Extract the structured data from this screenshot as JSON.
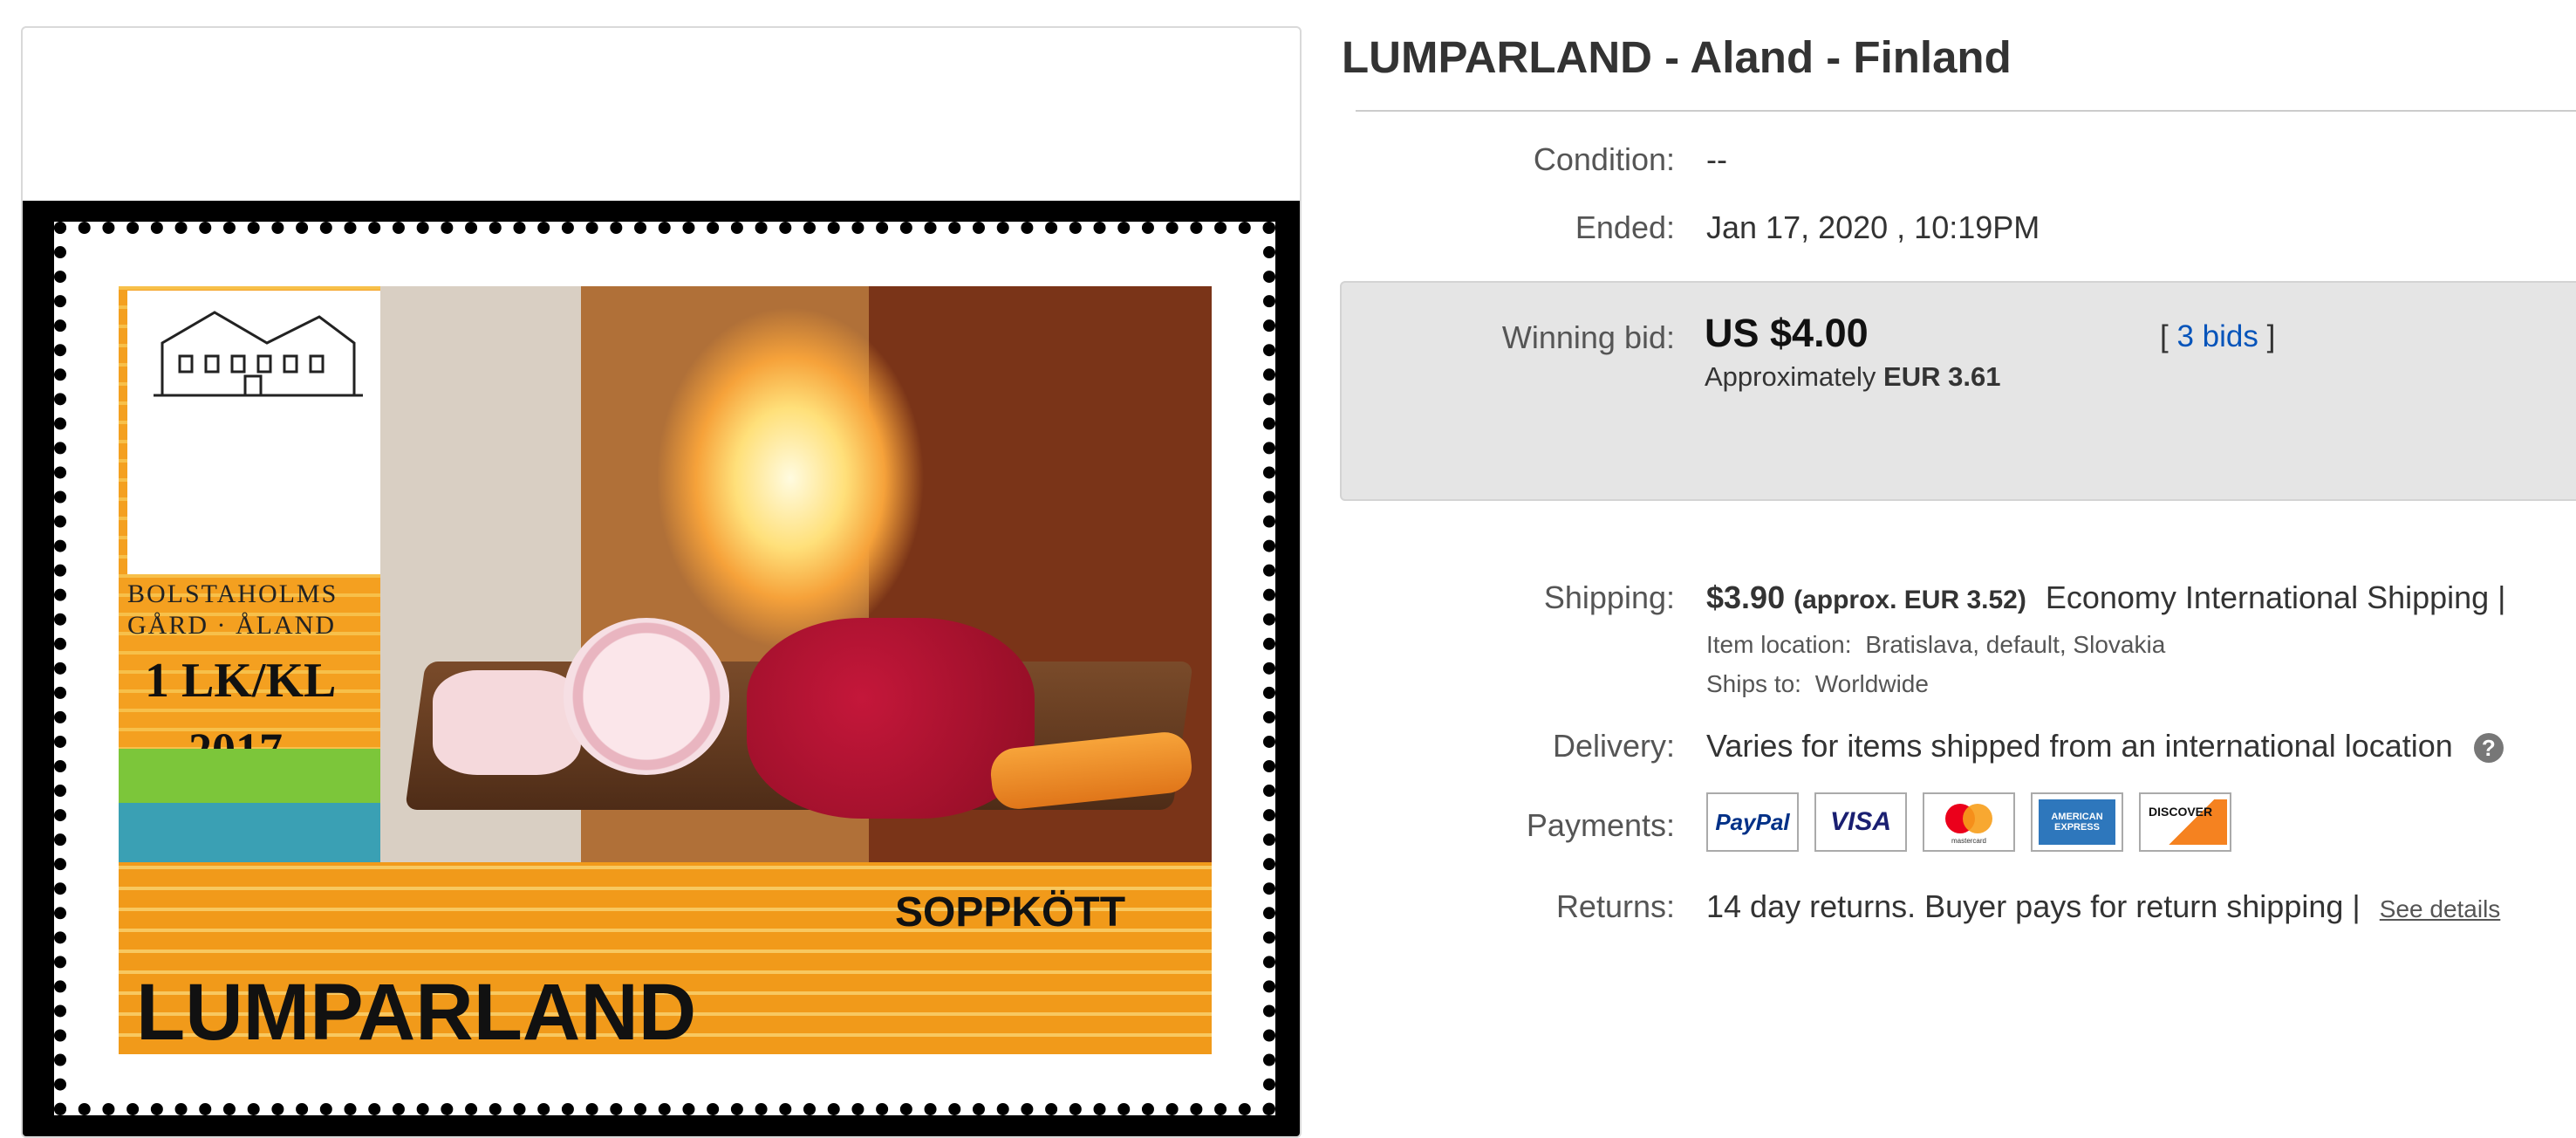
{
  "listing": {
    "title": "LUMPARLAND - Aland - Finland"
  },
  "stamp": {
    "estate_line1": "BOLSTAHOLMS",
    "estate_line2": "GÅRD · ÅLAND",
    "value": "1 LK/KL",
    "year": "2017",
    "caption": "SOPPKÖTT",
    "place": "LUMPARLAND"
  },
  "details": {
    "condition_label": "Condition:",
    "condition_value": "--",
    "ended_label": "Ended:",
    "ended_value": "Jan 17, 2020 , 10:19PM",
    "winning_bid_label": "Winning bid:",
    "winning_bid_value": "US $4.00",
    "approx_prefix": "Approximately",
    "approx_value": "EUR 3.61",
    "bids_open": "[",
    "bids_link": "3 bids",
    "bids_close": "]",
    "shipping_label": "Shipping:",
    "shipping_value": "$3.90",
    "shipping_approx": "(approx. EUR 3.52)",
    "shipping_method": "Economy International Shipping |",
    "item_location_label": "Item location:",
    "item_location_value": "Bratislava, default, Slovakia",
    "ships_to_label": "Ships to:",
    "ships_to_value": "Worldwide",
    "delivery_label": "Delivery:",
    "delivery_value": "Varies for items shipped from an international location",
    "delivery_help_icon": "?",
    "payments_label": "Payments:",
    "returns_label": "Returns:",
    "returns_value": "14 day returns. Buyer pays for return shipping |",
    "returns_link": "See details"
  },
  "payments": [
    {
      "name": "PayPal",
      "icon": "paypal-icon"
    },
    {
      "name": "VISA",
      "icon": "visa-icon"
    },
    {
      "name": "mastercard",
      "icon": "mastercard-icon"
    },
    {
      "name": "AMERICAN EXPRESS",
      "icon": "amex-icon"
    },
    {
      "name": "DISCOVER",
      "icon": "discover-icon"
    }
  ],
  "colors": {
    "link": "#0654ba",
    "bid_box": "#e5e5e5",
    "text": "#333333"
  }
}
